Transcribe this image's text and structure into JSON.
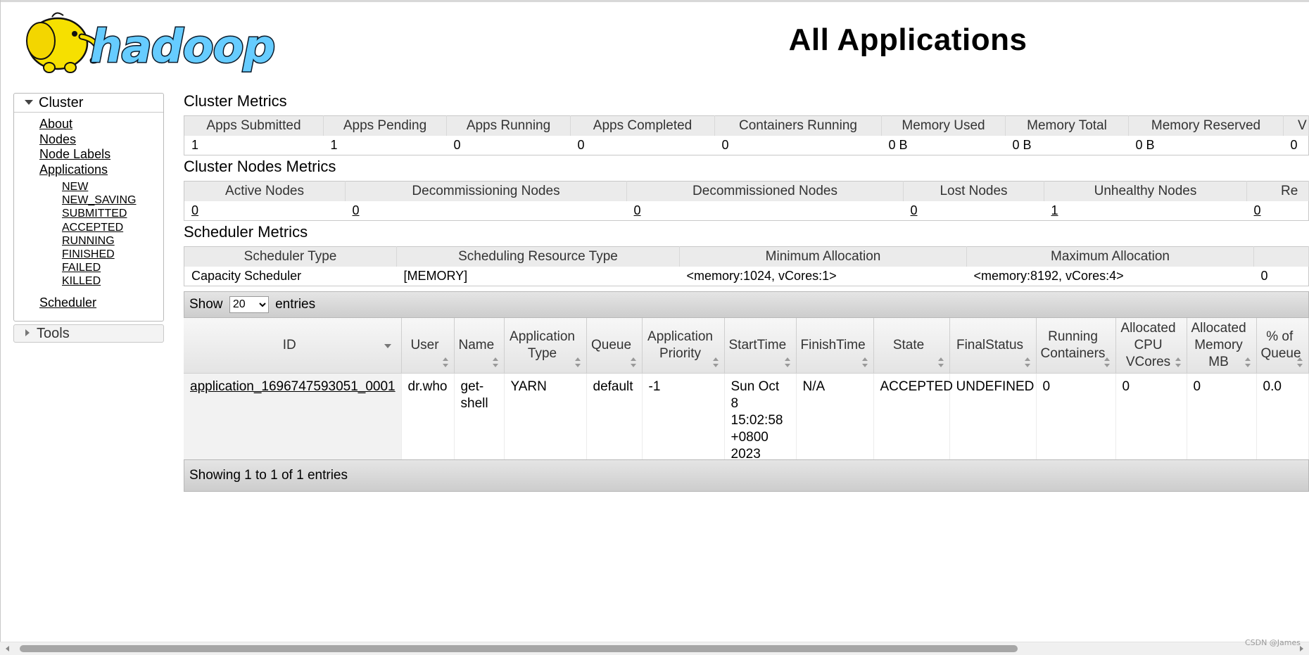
{
  "header": {
    "title": "All Applications",
    "logo_text": "hadoop"
  },
  "nav": {
    "cluster_label": "Cluster",
    "links": [
      "About",
      "Nodes",
      "Node Labels",
      "Applications"
    ],
    "app_states": [
      "NEW",
      "NEW_SAVING",
      "SUBMITTED",
      "ACCEPTED",
      "RUNNING",
      "FINISHED",
      "FAILED",
      "KILLED"
    ],
    "scheduler_label": "Scheduler",
    "tools_label": "Tools"
  },
  "cluster_metrics": {
    "title": "Cluster Metrics",
    "headers": [
      "Apps Submitted",
      "Apps Pending",
      "Apps Running",
      "Apps Completed",
      "Containers Running",
      "Memory Used",
      "Memory Total",
      "Memory Reserved",
      "V"
    ],
    "values": [
      "1",
      "1",
      "0",
      "0",
      "0",
      "0 B",
      "0 B",
      "0 B",
      "0"
    ]
  },
  "cluster_nodes_metrics": {
    "title": "Cluster Nodes Metrics",
    "headers": [
      "Active Nodes",
      "Decommissioning Nodes",
      "Decommissioned Nodes",
      "Lost Nodes",
      "Unhealthy Nodes",
      "Re"
    ],
    "values": [
      "0",
      "0",
      "0",
      "0",
      "1",
      "0"
    ]
  },
  "scheduler_metrics": {
    "title": "Scheduler Metrics",
    "headers": [
      "Scheduler Type",
      "Scheduling Resource Type",
      "Minimum Allocation",
      "Maximum Allocation",
      ""
    ],
    "values": [
      "Capacity Scheduler",
      "[MEMORY]",
      "<memory:1024, vCores:1>",
      "<memory:8192, vCores:4>",
      "0"
    ]
  },
  "apps_table": {
    "show_label": "Show",
    "entries_label": "entries",
    "page_size": "20",
    "page_size_options": [
      "20"
    ],
    "columns": [
      "ID",
      "User",
      "Name",
      "Application Type",
      "Queue",
      "Application Priority",
      "StartTime",
      "FinishTime",
      "State",
      "FinalStatus",
      "Running Containers",
      "Allocated CPU VCores",
      "Allocated Memory MB",
      "% of Queue"
    ],
    "rows": [
      [
        "application_1696747593051_0001",
        "dr.who",
        "get-shell",
        "YARN",
        "default",
        "-1",
        "Sun Oct 8 15:02:58 +0800 2023",
        "N/A",
        "ACCEPTED",
        "UNDEFINED",
        "0",
        "0",
        "0",
        "0.0"
      ]
    ],
    "footer": "Showing 1 to 1 of 1 entries"
  },
  "watermark": "CSDN @James",
  "colors": {
    "header_bg": "#ebebeb",
    "toolbar_bg": "#d4d4d4",
    "logo_yellow": "#f6e000",
    "logo_blue": "#66ccff"
  }
}
